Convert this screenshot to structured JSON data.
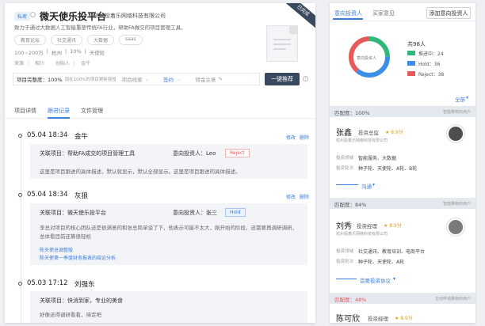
{
  "project": {
    "private_tag": "私密",
    "name": "微天使乐投平台",
    "company": "杭州投着乐网络科技有限公司",
    "description": "致力于通过大数据人工智能重塑传统FA行业，帮助FA做交的项目管理工具。",
    "tags": [
      "教育论坛",
      "社交通讯",
      "大数据",
      "saas"
    ],
    "meta": [
      "100~200万",
      "杭州",
      "10%",
      "天使轮"
    ],
    "source_label": "来源",
    "source_value": "相川",
    "creator_label": "创始人",
    "creator_value": "金牛",
    "corner_label": "已完成",
    "completeness_label": "项目完整度：100%",
    "completeness_hint": "现在100%的项目更新获投资人关注",
    "progress_label": "项目线索",
    "signed_value": "签约",
    "manager_label": "转金主意",
    "pitch_button": "一键推荐"
  },
  "tabs": [
    {
      "label": "项目详情"
    },
    {
      "label": "跟进记录"
    },
    {
      "label": "文件管理"
    }
  ],
  "records": [
    {
      "date": "05.04 18:34",
      "author": "金牛",
      "edit": "修改",
      "delete": "删除",
      "project_label": "关联项目：帮助FA成交的项目管理工具",
      "investor_label": "意向投资人：Leo",
      "status": "Reject",
      "body": "这里是项目跟进的具体描述，默认就显示，默认全部显示。这里是项目跟进的具体描述。"
    },
    {
      "date": "05.04 18:34",
      "author": "灰狼",
      "edit": "修改",
      "delete": "删除",
      "project_label": "关联项目：微天使乐投平台",
      "investor_label": "意向投资人：张三",
      "status": "Hold",
      "body": "李总对项目的核心团队还是很满意的和张总简单谈了下，他表示可能不太大，刚开始的阶段，还需要再调研调研，总体看目前还算很轻松",
      "attach1": "陈天使总调整版",
      "attach2": "陈天使第一季度财务报表的结论分析"
    },
    {
      "date": "05.03 17:12",
      "author": "刘强东",
      "project_label": "关联项目：快消到家，专业的美食",
      "body": "好像还得调研看看，待定吧"
    }
  ],
  "right": {
    "tab_intent": "意向投资人",
    "tab_buyer": "买家意见",
    "add_button": "添加意向投资人",
    "donut_label": "意向投资人",
    "total": "共98人",
    "legend": [
      {
        "label": "推进中：24",
        "color": "#2fb87a"
      },
      {
        "label": "Hold：36",
        "color": "#3b8fe8"
      },
      {
        "label": "Reject：38",
        "color": "#e85a5a"
      }
    ],
    "all_link": "全部"
  },
  "chart_data": {
    "type": "pie",
    "categories": [
      "推进中",
      "Hold",
      "Reject"
    ],
    "values": [
      24,
      36,
      38
    ],
    "colors": [
      "#2fb87a",
      "#3b8fe8",
      "#e85a5a"
    ],
    "title": "意向投资人"
  },
  "investors": [
    {
      "match": "匹配度：100%",
      "hint": "智能推荐的用户",
      "name": "张鑫",
      "role": "投资总监",
      "score": "8.9分",
      "company": "杭州投着乐网络科技有限公司",
      "field_label": "投资领域",
      "field_value": "智能服务、大数据",
      "stage_label": "投资轮次",
      "stage_value": "种子轮、天使轮、A轮、B轮",
      "action": "沟通"
    },
    {
      "match": "匹配度：84%",
      "hint": "智能推荐的用户",
      "name": "刘秀",
      "role": "投资经理",
      "score": "8.9分",
      "company": "杭州投着乐网络科技有限公司",
      "field_label": "投资领域",
      "field_value": "社交通讯、教育培训、电商平台",
      "stage_label": "投资轮次",
      "stage_value": "种子轮、天使轮、A轮",
      "action": "首要投资协议"
    },
    {
      "match": "匹配度：48%",
      "hint": "主动申请推荐的用户",
      "name": "陈可欣",
      "role": "投资经理",
      "score": "8.9分"
    }
  ]
}
